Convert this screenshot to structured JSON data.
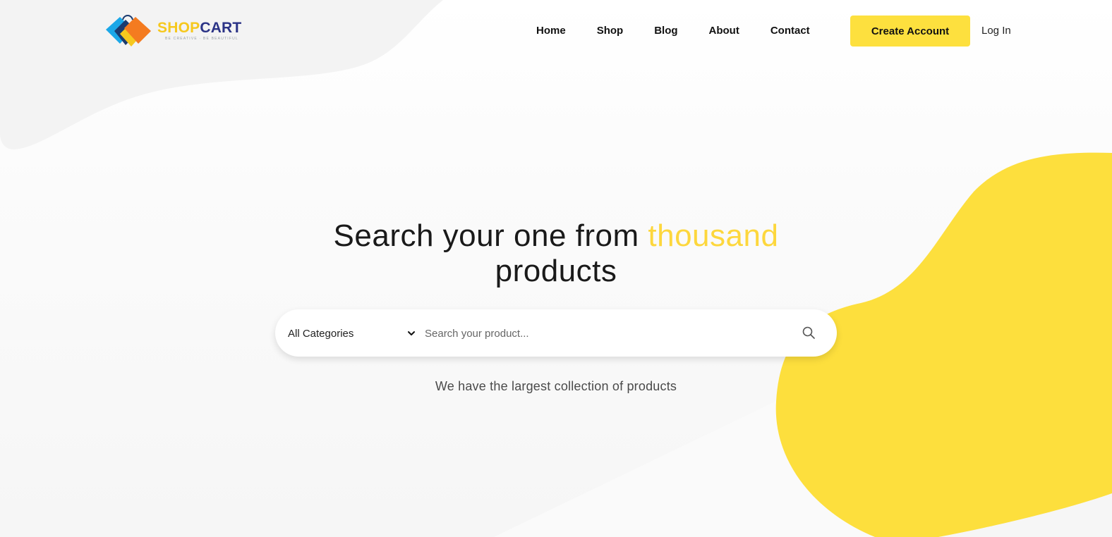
{
  "brand": {
    "name_part_a": "SHOP",
    "name_part_b": "CART",
    "tagline": "BE CREATIVE · BE BEAUTIFUL"
  },
  "nav": {
    "items": [
      {
        "label": "Home"
      },
      {
        "label": "Shop"
      },
      {
        "label": "Blog"
      },
      {
        "label": "About"
      },
      {
        "label": "Contact"
      }
    ],
    "cta_label": "Create Account",
    "login_label": "Log In"
  },
  "hero": {
    "title_part1": "Search your one from ",
    "title_accent": "thousand",
    "title_part2": "products",
    "subtitle": "We have the largest collection of products"
  },
  "search": {
    "category_selected": "All Categories",
    "placeholder": "Search your product..."
  },
  "colors": {
    "accent_yellow": "#fde03e",
    "brand_navy": "#2b3386",
    "logo_orange": "#f47b20",
    "logo_blue": "#1aa7e8"
  },
  "icons": {
    "search": "magnifier-icon",
    "dropdown": "chevron-down-icon",
    "logo": "shopping-bags-icon"
  }
}
